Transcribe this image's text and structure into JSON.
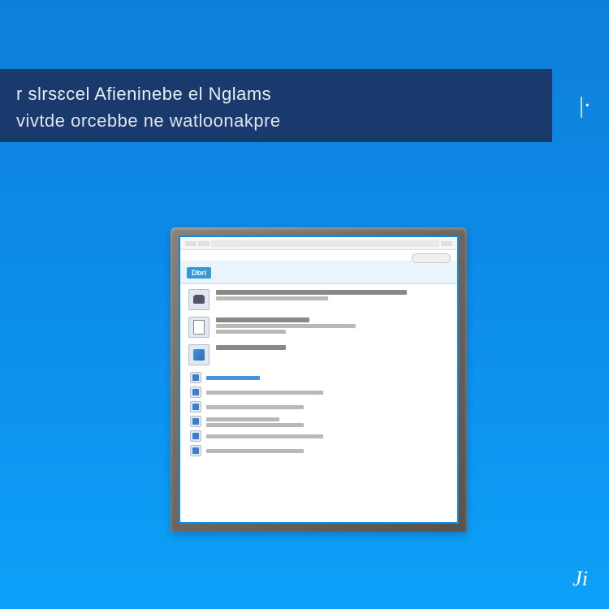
{
  "banner": {
    "line1": "r slrsɛcel Afieninebe el Nglams",
    "line2": "vivtde orcebbe ne watloonakpre"
  },
  "marks": {
    "right": "|·",
    "bottom": "Ji"
  },
  "window": {
    "header_badge": "Dbri",
    "header_text": "",
    "subheader_link": "",
    "section_label": ""
  }
}
